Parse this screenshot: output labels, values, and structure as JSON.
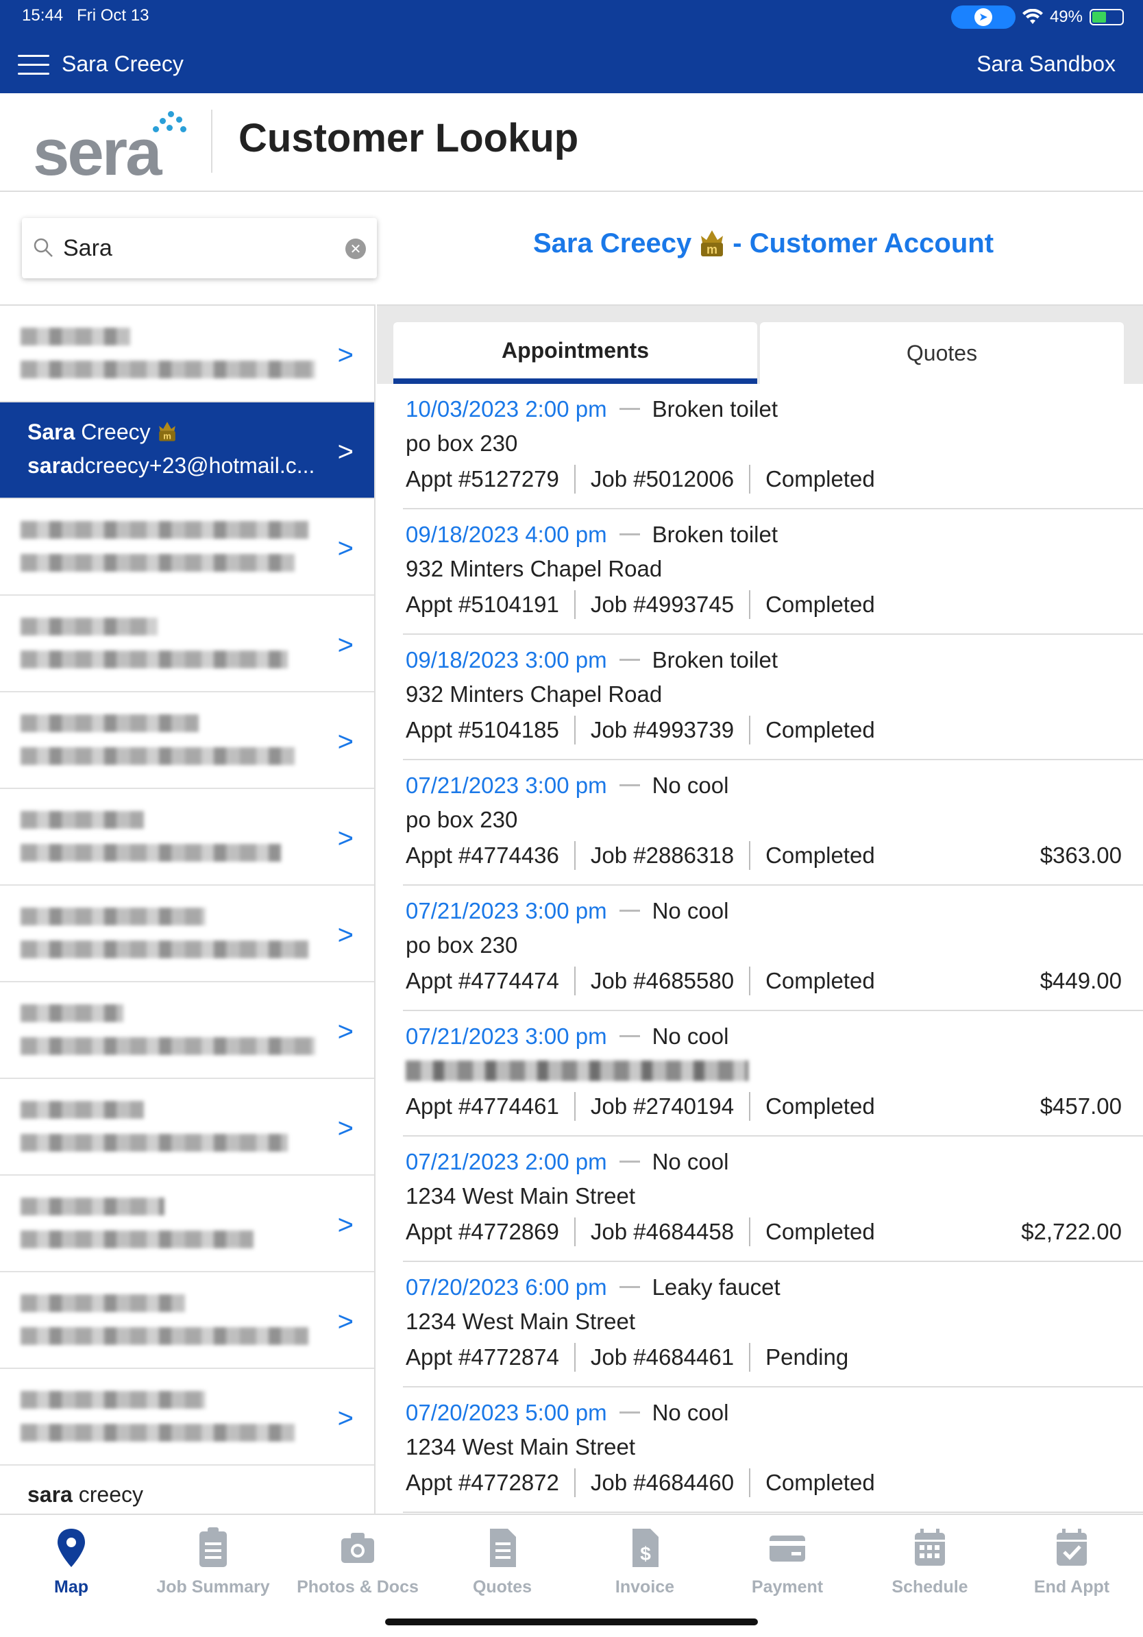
{
  "status": {
    "time": "15:44",
    "date": "Fri Oct 13",
    "battery": "49%",
    "battery_level": 0.49
  },
  "nav": {
    "user": "Sara Creecy",
    "sandbox": "Sara Sandbox"
  },
  "header": {
    "logo": "sera",
    "title": "Customer Lookup"
  },
  "search": {
    "value": "Sara"
  },
  "account": {
    "name": "Sara Creecy",
    "suffix": "- Customer Account",
    "badge_icon": "member-crown-icon"
  },
  "customers": {
    "active": {
      "name_bold": "Sara",
      "name_rest": " Creecy",
      "email_bold": "sara",
      "email_rest": "dcreecy+23@hotmail.c..."
    },
    "last": {
      "name_bold": "sara",
      "name_rest": " creecy"
    }
  },
  "tabs": [
    {
      "label": "Appointments"
    },
    {
      "label": "Quotes"
    }
  ],
  "appointments": [
    {
      "date": "10/03/2023 2:00 pm",
      "issue": "Broken toilet",
      "address": "po box 230",
      "appt": "Appt #5127279",
      "job": "Job #5012006",
      "status": "Completed",
      "amount": ""
    },
    {
      "date": "09/18/2023 4:00 pm",
      "issue": "Broken toilet",
      "address": "932 Minters Chapel Road",
      "appt": "Appt #5104191",
      "job": "Job #4993745",
      "status": "Completed",
      "amount": ""
    },
    {
      "date": "09/18/2023 3:00 pm",
      "issue": "Broken toilet",
      "address": "932 Minters Chapel Road",
      "appt": "Appt #5104185",
      "job": "Job #4993739",
      "status": "Completed",
      "amount": ""
    },
    {
      "date": "07/21/2023 3:00 pm",
      "issue": "No cool",
      "address": "po box 230",
      "appt": "Appt #4774436",
      "job": "Job #2886318",
      "status": "Completed",
      "amount": "$363.00"
    },
    {
      "date": "07/21/2023 3:00 pm",
      "issue": "No cool",
      "address": "po box 230",
      "appt": "Appt #4774474",
      "job": "Job #4685580",
      "status": "Completed",
      "amount": "$449.00"
    },
    {
      "date": "07/21/2023 3:00 pm",
      "issue": "No cool",
      "address": "",
      "appt": "Appt #4774461",
      "job": "Job #2740194",
      "status": "Completed",
      "amount": "$457.00"
    },
    {
      "date": "07/21/2023 2:00 pm",
      "issue": "No cool",
      "address": "1234 West Main Street",
      "appt": "Appt #4772869",
      "job": "Job #4684458",
      "status": "Completed",
      "amount": "$2,722.00"
    },
    {
      "date": "07/20/2023 6:00 pm",
      "issue": "Leaky faucet",
      "address": "1234 West Main Street",
      "appt": "Appt #4772874",
      "job": "Job #4684461",
      "status": "Pending",
      "amount": ""
    },
    {
      "date": "07/20/2023 5:00 pm",
      "issue": "No cool",
      "address": "1234 West Main Street",
      "appt": "Appt #4772872",
      "job": "Job #4684460",
      "status": "Completed",
      "amount": ""
    }
  ],
  "bottom_nav": [
    {
      "label": "Map",
      "icon": "map-pin-icon"
    },
    {
      "label": "Job Summary",
      "icon": "clipboard-icon"
    },
    {
      "label": "Photos & Docs",
      "icon": "camera-icon"
    },
    {
      "label": "Quotes",
      "icon": "document-icon"
    },
    {
      "label": "Invoice",
      "icon": "invoice-icon"
    },
    {
      "label": "Payment",
      "icon": "credit-card-icon"
    },
    {
      "label": "Schedule",
      "icon": "calendar-icon"
    },
    {
      "label": "End Appt",
      "icon": "calendar-check-icon"
    }
  ],
  "colors": {
    "brand": "#0f3d99",
    "accent": "#1a78e8",
    "inactive": "#a9b0b8"
  }
}
